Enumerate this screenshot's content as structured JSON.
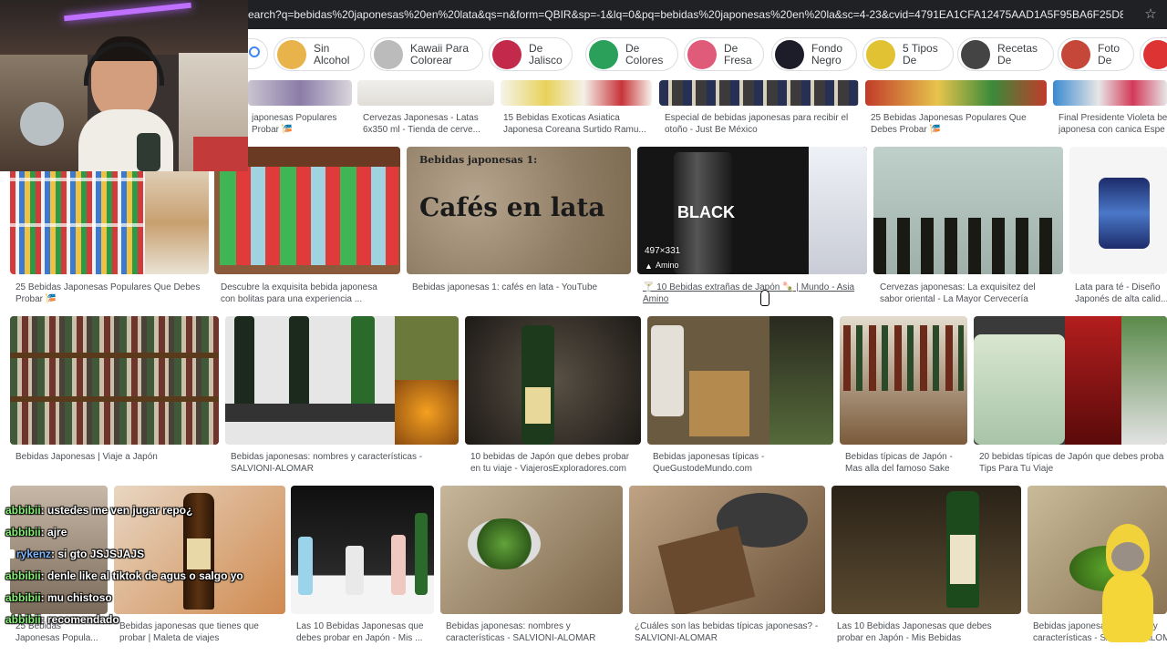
{
  "browser": {
    "url": "earch?q=bebidas%20japonesas%20en%20lata&qs=n&form=QBIR&sp=-1&lq=0&pq=bebidas%20japonesas%20en%20la&sc=4-23&cvid=4791EA1CFA12475AAD1A5F95BA6F25D8&first=1",
    "star_icon": "☆"
  },
  "chips": [
    {
      "label": "Sin Alcohol",
      "color": "#e8b34a"
    },
    {
      "label": "Kawaii Para Colorear",
      "color": "#bbbbbb"
    },
    {
      "label": "De Jalisco",
      "color": "#c2294a"
    },
    {
      "label": "De Colores",
      "color": "#2aa05a"
    },
    {
      "label": "De Fresa",
      "color": "#e05a7a"
    },
    {
      "label": "Fondo Negro",
      "color": "#1d1d2a"
    },
    {
      "label": "5 Tipos De",
      "color": "#e0c232"
    },
    {
      "label": "Recetas De",
      "color": "#444444"
    },
    {
      "label": "Foto De",
      "color": "#c4473a"
    }
  ],
  "row0": [
    {
      "caption": "japonesas Populares\nProbar 🎏"
    },
    {
      "caption": "Cervezas Japonesas - Latas\n6x350 ml - Tienda de cerve..."
    },
    {
      "caption": "15 Bebidas Exoticas Asiatica\nJaponesa Coreana Surtido Ramu..."
    },
    {
      "caption": "Especial de bebidas japonesas para recibir el\notoño - Just Be México"
    },
    {
      "caption": "25 Bebidas Japonesas Populares Que\nDebes Probar 🎏"
    },
    {
      "caption": "Final Presidente Violeta be\njaponesa con canica Espe"
    }
  ],
  "row1": [
    {
      "caption": "25 Bebidas Japonesas Populares Que Debes\nProbar 🎏"
    },
    {
      "caption": "Descubre la exquisita bebida japonesa\ncon bolitas para una experiencia ..."
    },
    {
      "caption": "Bebidas japonesas 1: cafés en lata - YouTube",
      "overlay_small": "Bebidas japonesas 1:",
      "overlay_big": "Cafés en lata"
    },
    {
      "caption": "🍸 10 Bebidas extrañas de Japón 🍡 | Mundo - Asia\nAmino",
      "dimensions": "497×331",
      "source": "Amino",
      "can_text": "BLACK"
    },
    {
      "caption": "Cervezas japonesas: La exquisitez del\nsabor oriental - La Mayor Cervecería"
    },
    {
      "caption": "Lata para té - Diseño\nJaponés de alta calid..."
    }
  ],
  "row2": [
    {
      "caption": "Bebidas Japonesas | Viaje a Japón"
    },
    {
      "caption": "Bebidas japonesas: nombres y características -\nSALVIONI-ALOMAR"
    },
    {
      "caption": "10 bebidas de Japón que debes probar\nen tu viaje - ViajerosExploradores.com"
    },
    {
      "caption": "Bebidas japonesas típicas -\nQueGustodeMundo.com"
    },
    {
      "caption": "Bebidas típicas de Japón -\nMas alla del famoso Sake"
    },
    {
      "caption": "20 bebidas típicas de Japón que debes proba\nTips Para Tu Viaje"
    }
  ],
  "row3": [
    {
      "caption": "25 Bebidas\nJaponesas Popula..."
    },
    {
      "caption": "Bebidas japonesas que tienes que\nprobar | Maleta de viajes"
    },
    {
      "caption": "Las 10 Bebidas Japonesas que\ndebes probar en Japón - Mis ..."
    },
    {
      "caption": "Bebidas japonesas: nombres y\ncaracterísticas - SALVIONI-ALOMAR"
    },
    {
      "caption": "¿Cuáles son las bebidas típicas japonesas? -\nSALVIONI-ALOMAR"
    },
    {
      "caption": "Las 10 Bebidas Japonesas que debes\nprobar en Japón - Mis Bebidas"
    },
    {
      "caption": "Bebidas japonesas: nombres y\ncaracterísticas - SALVIONI-ALOM"
    }
  ],
  "chat": [
    {
      "user": "abbibii",
      "text": "ustedes me ven jugar repo¿",
      "badge": false
    },
    {
      "user": "abbibii",
      "text": "ajre",
      "badge": false
    },
    {
      "user": "rykenz",
      "text": "si gto JSJSJAJS",
      "badge": true
    },
    {
      "user": "abbibii",
      "text": "denle like al tiktok de agus o salgo yo",
      "badge": false
    },
    {
      "user": "abbibii",
      "text": "mu chistoso",
      "badge": false
    },
    {
      "user": "abbibii",
      "text": "recomendado",
      "badge": false
    }
  ]
}
